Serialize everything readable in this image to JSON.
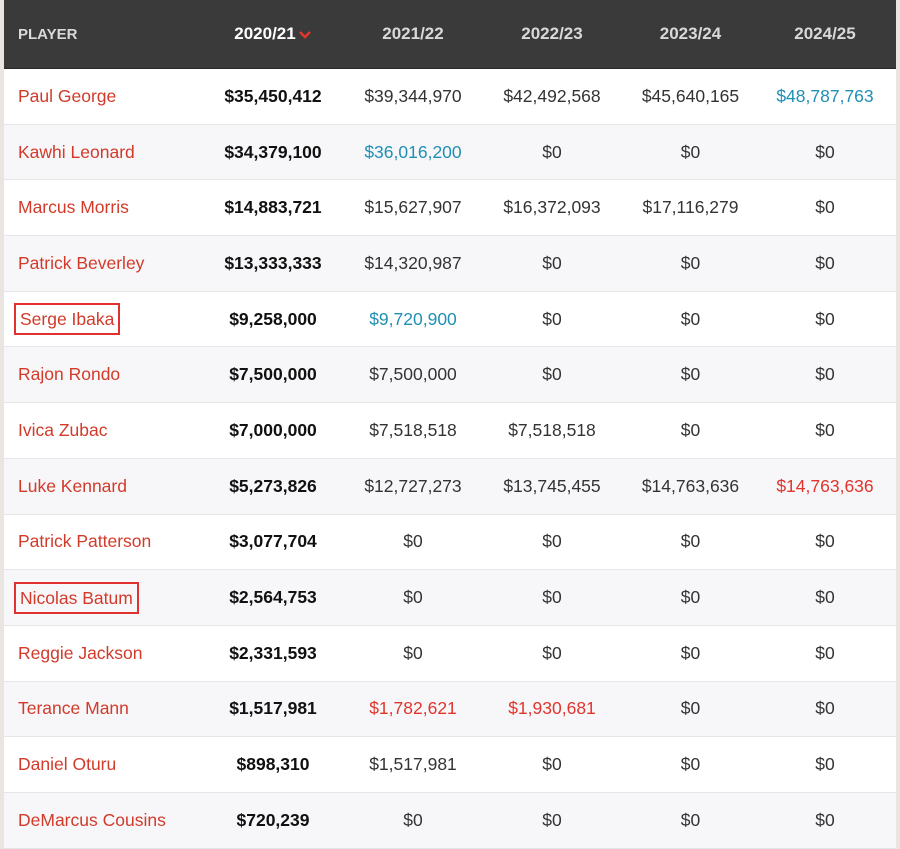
{
  "colors": {
    "header_bg": "#3a3a3a",
    "player_name": "#d23a2a",
    "team_option": "#1f8fb3",
    "player_option": "#e0342c",
    "highlight_box": "#e13030"
  },
  "header": {
    "player_label": "PLAYER",
    "seasons": [
      "2020/21",
      "2021/22",
      "2022/23",
      "2023/24",
      "2024/25"
    ],
    "sort_icon": "chevron-down-icon"
  },
  "rows": [
    {
      "name": "Paul George",
      "boxed": false,
      "values": [
        "$35,450,412",
        "$39,344,970",
        "$42,492,568",
        "$45,640,165",
        "$48,787,763"
      ],
      "styles": [
        "",
        "",
        "",
        "",
        "team"
      ]
    },
    {
      "name": "Kawhi Leonard",
      "boxed": false,
      "values": [
        "$34,379,100",
        "$36,016,200",
        "$0",
        "$0",
        "$0"
      ],
      "styles": [
        "",
        "team",
        "",
        "",
        ""
      ]
    },
    {
      "name": "Marcus Morris",
      "boxed": false,
      "values": [
        "$14,883,721",
        "$15,627,907",
        "$16,372,093",
        "$17,116,279",
        "$0"
      ],
      "styles": [
        "",
        "",
        "",
        "",
        ""
      ]
    },
    {
      "name": "Patrick Beverley",
      "boxed": false,
      "values": [
        "$13,333,333",
        "$14,320,987",
        "$0",
        "$0",
        "$0"
      ],
      "styles": [
        "",
        "",
        "",
        "",
        ""
      ]
    },
    {
      "name": "Serge Ibaka",
      "boxed": true,
      "values": [
        "$9,258,000",
        "$9,720,900",
        "$0",
        "$0",
        "$0"
      ],
      "styles": [
        "",
        "team",
        "",
        "",
        ""
      ]
    },
    {
      "name": "Rajon Rondo",
      "boxed": false,
      "values": [
        "$7,500,000",
        "$7,500,000",
        "$0",
        "$0",
        "$0"
      ],
      "styles": [
        "",
        "",
        "",
        "",
        ""
      ]
    },
    {
      "name": "Ivica Zubac",
      "boxed": false,
      "values": [
        "$7,000,000",
        "$7,518,518",
        "$7,518,518",
        "$0",
        "$0"
      ],
      "styles": [
        "",
        "",
        "",
        "",
        ""
      ]
    },
    {
      "name": "Luke Kennard",
      "boxed": false,
      "values": [
        "$5,273,826",
        "$12,727,273",
        "$13,745,455",
        "$14,763,636",
        "$14,763,636"
      ],
      "styles": [
        "",
        "",
        "",
        "",
        "player"
      ]
    },
    {
      "name": "Patrick Patterson",
      "boxed": false,
      "values": [
        "$3,077,704",
        "$0",
        "$0",
        "$0",
        "$0"
      ],
      "styles": [
        "",
        "",
        "",
        "",
        ""
      ]
    },
    {
      "name": "Nicolas Batum",
      "boxed": true,
      "values": [
        "$2,564,753",
        "$0",
        "$0",
        "$0",
        "$0"
      ],
      "styles": [
        "",
        "",
        "",
        "",
        ""
      ]
    },
    {
      "name": "Reggie Jackson",
      "boxed": false,
      "values": [
        "$2,331,593",
        "$0",
        "$0",
        "$0",
        "$0"
      ],
      "styles": [
        "",
        "",
        "",
        "",
        ""
      ]
    },
    {
      "name": "Terance Mann",
      "boxed": false,
      "values": [
        "$1,517,981",
        "$1,782,621",
        "$1,930,681",
        "$0",
        "$0"
      ],
      "styles": [
        "",
        "player",
        "player",
        "",
        ""
      ]
    },
    {
      "name": "Daniel Oturu",
      "boxed": false,
      "values": [
        "$898,310",
        "$1,517,981",
        "$0",
        "$0",
        "$0"
      ],
      "styles": [
        "",
        "",
        "",
        "",
        ""
      ]
    },
    {
      "name": "DeMarcus Cousins",
      "boxed": false,
      "values": [
        "$720,239",
        "$0",
        "$0",
        "$0",
        "$0"
      ],
      "styles": [
        "",
        "",
        "",
        "",
        ""
      ]
    }
  ]
}
